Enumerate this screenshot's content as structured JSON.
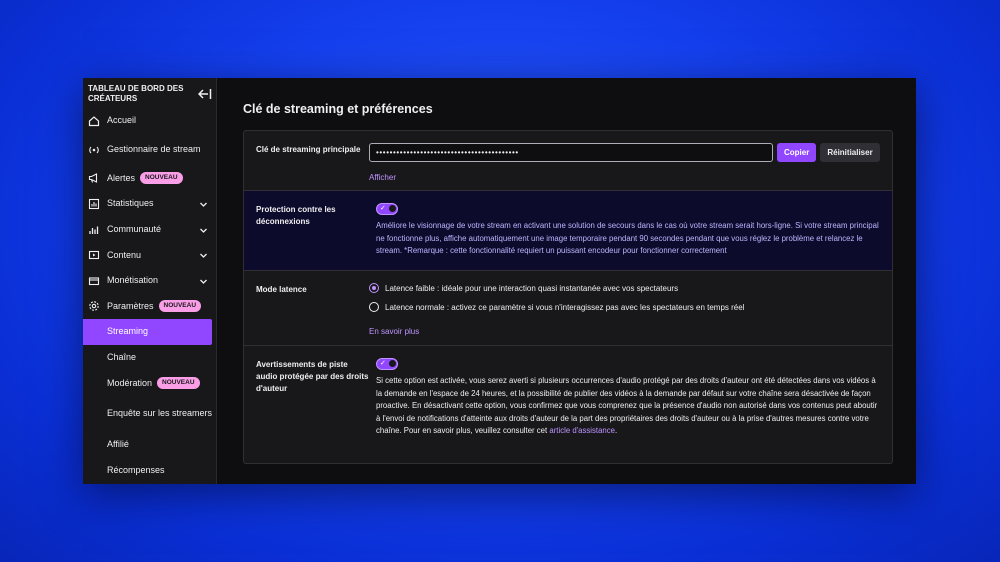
{
  "sidebar": {
    "title": "TABLEAU DE BORD DES CRÉATEURS",
    "items": [
      {
        "label": "Accueil"
      },
      {
        "label": "Gestionnaire de stream"
      },
      {
        "label": "Alertes",
        "badge": "NOUVEAU"
      },
      {
        "label": "Statistiques"
      },
      {
        "label": "Communauté"
      },
      {
        "label": "Contenu"
      },
      {
        "label": "Monétisation"
      },
      {
        "label": "Paramètres",
        "badge": "NOUVEAU"
      }
    ],
    "sub_items": [
      {
        "label": "Streaming"
      },
      {
        "label": "Chaîne"
      },
      {
        "label": "Modération",
        "badge": "NOUVEAU"
      },
      {
        "label": "Enquête sur les streamers"
      },
      {
        "label": "Affilié"
      },
      {
        "label": "Récompenses"
      }
    ]
  },
  "main": {
    "title": "Clé de streaming et préférences",
    "stream_key": {
      "label": "Clé de streaming principale",
      "value": "••••••••••••••••••••••••••••••••••••••••••",
      "copy_label": "Copier",
      "reset_label": "Réinitialiser",
      "show_label": "Afficher"
    },
    "disconnect": {
      "label": "Protection contre les déconnexions",
      "description": "Améliore le visionnage de votre stream en activant une solution de secours dans le cas où votre stream serait hors-ligne. Si votre stream principal ne fonctionne plus, affiche automatiquement une image temporaire pendant 90 secondes pendant que vous réglez le problème et relancez le stream. *Remarque : cette fonctionnalité requiert un puissant encodeur pour fonctionner correctement",
      "enabled": true
    },
    "latency": {
      "label": "Mode latence",
      "options": [
        "Latence faible : idéale pour une interaction quasi instantanée avec vos spectateurs",
        "Latence normale : activez ce paramètre si vous n'interagissez pas avec les spectateurs en temps réel"
      ],
      "selected": 0,
      "learn_more": "En savoir plus"
    },
    "copyright": {
      "label": "Avertissements de piste audio protégée par des droits d'auteur",
      "description": "Si cette option est activée, vous serez averti si plusieurs occurrences d'audio protégé par des droits d'auteur ont été détectées dans vos vidéos à la demande en l'espace de 24 heures, et la possibilité de publier des vidéos à la demande par défaut sur votre chaîne sera désactivée de façon proactive. En désactivant cette option, vous confirmez que vous comprenez que la présence d'audio non autorisé dans vos contenus peut aboutir à l'envoi de notifications d'atteinte aux droits d'auteur de la part des propriétaires des droits d'auteur ou à la prise d'autres mesures contre votre chaîne. Pour en savoir plus, veuillez consulter cet",
      "link": "article d'assistance",
      "link_suffix": ".",
      "enabled": true
    }
  },
  "colors": {
    "accent": "#9147ff",
    "badge": "#fa9fe7",
    "background": "#0e0e10",
    "highlight": "#0c0b2b"
  },
  "icons": [
    "collapse-sidebar-icon",
    "home-icon",
    "broadcast-icon",
    "megaphone-icon",
    "stats-icon",
    "community-icon",
    "content-icon",
    "money-icon",
    "gear-icon",
    "chevron-down-icon",
    "checkmark-icon"
  ]
}
